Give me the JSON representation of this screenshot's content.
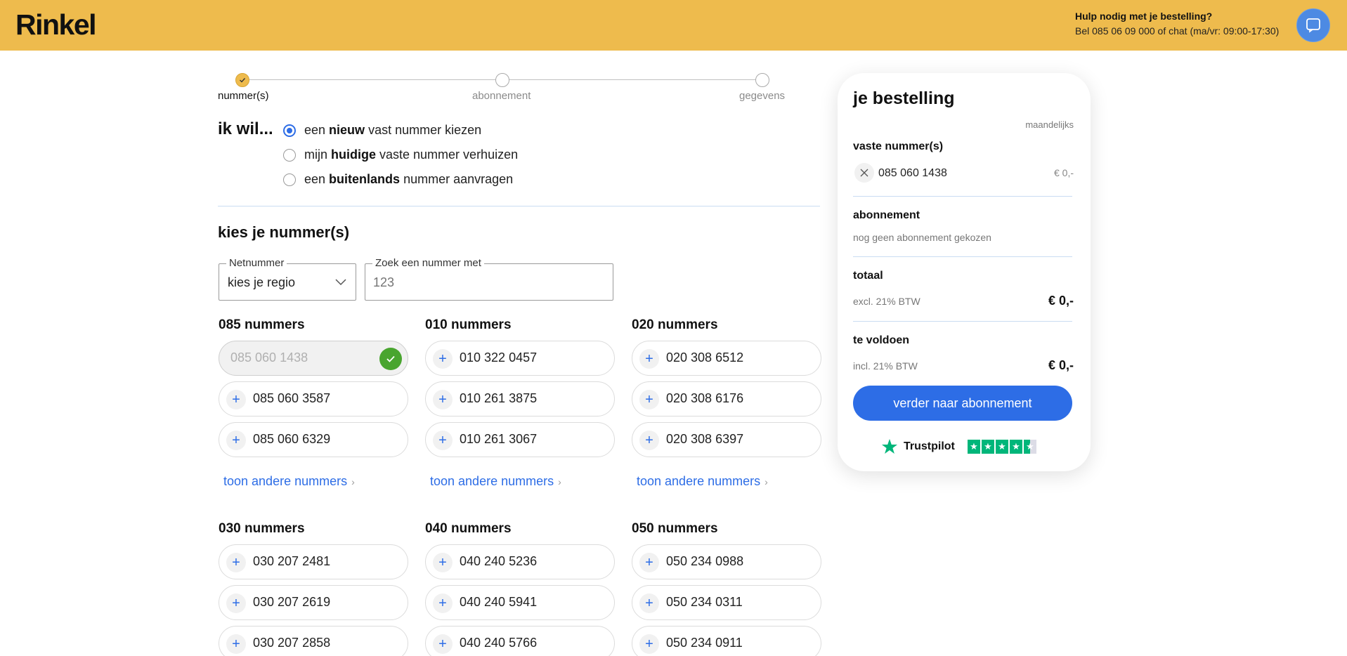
{
  "brand": {
    "logo_text": "Rinkel",
    "accent_color": "#eebb4d",
    "primary_color": "#2d6de6"
  },
  "header": {
    "help_title": "Hulp nodig met je bestelling?",
    "help_sub": "Bel 085 06 09 000 of chat (ma/vr: 09:00-17:30)",
    "chat_icon": "chat-icon"
  },
  "stepper": {
    "steps": [
      {
        "label": "nummer(s)",
        "status": "done"
      },
      {
        "label": "abonnement",
        "status": "pending"
      },
      {
        "label": "gegevens",
        "status": "pending"
      }
    ]
  },
  "choice": {
    "prefix": "ik wil...",
    "options": [
      {
        "pre": "een ",
        "bold": "nieuw",
        "post": " vast nummer kiezen",
        "checked": true
      },
      {
        "pre": "mijn ",
        "bold": "huidige",
        "post": " vaste nummer verhuizen",
        "checked": false
      },
      {
        "pre": "een ",
        "bold": "buitenlands",
        "post": " nummer aanvragen",
        "checked": false
      }
    ]
  },
  "picker": {
    "title": "kies je nummer(s)",
    "netnummer_label": "Netnummer",
    "netnummer_value": "kies je regio",
    "search_label": "Zoek een nummer met",
    "search_placeholder": "123"
  },
  "groups": [
    {
      "title": "085 nummers",
      "numbers": [
        "085 060 1438",
        "085 060 3587",
        "085 060 6329"
      ],
      "selected_index": 0,
      "more": "toon andere nummers"
    },
    {
      "title": "010 nummers",
      "numbers": [
        "010 322 0457",
        "010 261 3875",
        "010 261 3067"
      ],
      "more": "toon andere nummers"
    },
    {
      "title": "020 nummers",
      "numbers": [
        "020 308 6512",
        "020 308 6176",
        "020 308 6397"
      ],
      "more": "toon andere nummers"
    },
    {
      "title": "030 nummers",
      "numbers": [
        "030 207 2481",
        "030 207 2619",
        "030 207 2858"
      ]
    },
    {
      "title": "040 nummers",
      "numbers": [
        "040 240 5236",
        "040 240 5941",
        "040 240 5766"
      ]
    },
    {
      "title": "050 nummers",
      "numbers": [
        "050 234 0988",
        "050 234 0311",
        "050 234 0911"
      ]
    }
  ],
  "order": {
    "title": "je bestelling",
    "frequency": "maandelijks",
    "numbers_heading": "vaste nummer(s)",
    "number": "085 060 1438",
    "number_price": "€ 0,-",
    "subscription_heading": "abonnement",
    "subscription_value": "nog geen abonnement gekozen",
    "total_heading": "totaal",
    "total_sub": "excl. 21% BTW",
    "total_price": "€ 0,-",
    "due_heading": "te voldoen",
    "due_sub": "incl. 21% BTW",
    "due_price": "€ 0,-",
    "cta": "verder naar abonnement",
    "trustpilot_name": "Trustpilot",
    "trustpilot_rating": 4.5
  }
}
